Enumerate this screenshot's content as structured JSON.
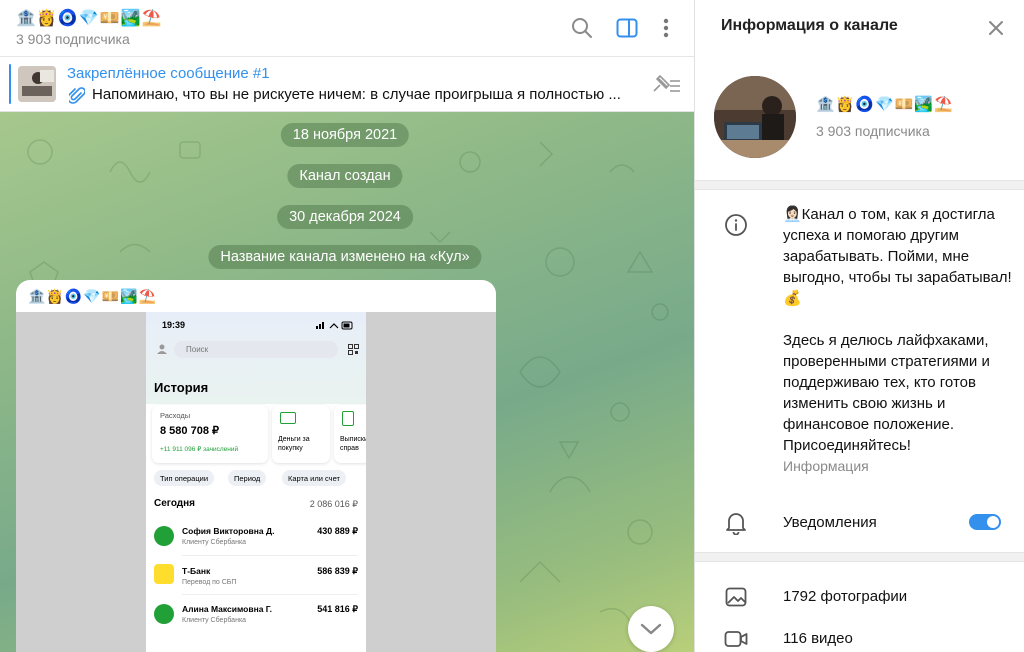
{
  "chat": {
    "title": "🏦👸🧿💎💴🏞️⛱️",
    "subscribers": "3 903 подписчика",
    "pinned": {
      "title": "Закреплённое сообщение #1",
      "text": "Напоминаю, что вы не рискуете ничем: в случае проигрыша я полностью ..."
    },
    "service_messages": [
      "18 ноября 2021",
      "Канал создан",
      "30 декабря 2024",
      "Название канала изменено на «Кул»"
    ],
    "post": {
      "author": "🏦👸🧿💎💴🏞️⛱️",
      "phone": {
        "time": "19:39",
        "search_placeholder": "Поиск",
        "history_title": "История",
        "expenses_label": "Расходы",
        "expenses_value": "8 580 708 ₽",
        "incoming": "+11 911 096 ₽ зачислений",
        "card2_text": "Деньги за покупку",
        "card3_text": "Выписки и справ",
        "filters": [
          "Тип операции",
          "Период",
          "Карта или счет"
        ],
        "today_label": "Сегодня",
        "today_total": "2 086 016 ₽",
        "transactions": [
          {
            "name": "София Викторовна Д.",
            "sub": "Клиенту Сбербанка",
            "amount": "430 889 ₽"
          },
          {
            "name": "Т-Банк",
            "sub": "Перевод по СБП",
            "amount": "586 839 ₽"
          },
          {
            "name": "Алина Максимовна Г.",
            "sub": "Клиенту Сбербанка",
            "amount": "541 816 ₽"
          }
        ]
      }
    }
  },
  "info": {
    "title": "Информация о канале",
    "name": "🏦👸🧿💎💴🏞️⛱️",
    "subscribers": "3 903 подписчика",
    "about_p1": "👩🏻‍💼Канал о том, как я достигла успеха и помогаю другим зарабатывать. Пойми, мне выгодно, чтобы ты зарабатывал!💰",
    "about_p2": "Здесь я делюсь лайфхаками, проверенными стратегиями и поддерживаю тех, кто готов изменить свою жизнь и финансовое положение. Присоединяйтесь!",
    "about_label": "Информация",
    "notifications_label": "Уведомления",
    "notifications_on": true,
    "photos": "1792 фотографии",
    "videos": "116 видео"
  },
  "colors": {
    "accent": "#3390ec",
    "secondary_text": "#8a8a8a",
    "sber_green": "#21a038"
  }
}
